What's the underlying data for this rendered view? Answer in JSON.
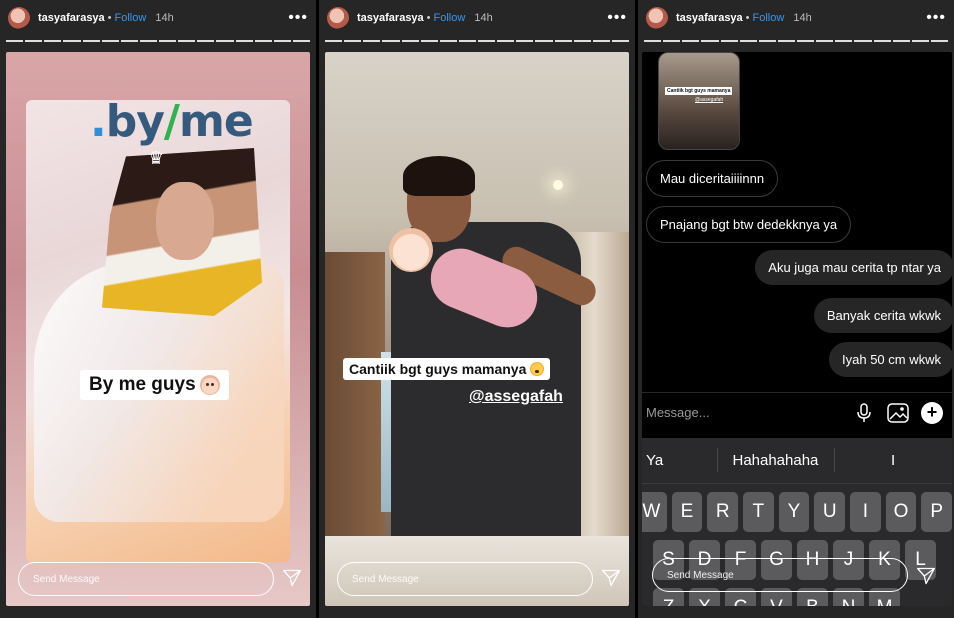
{
  "stories": [
    {
      "username": "tasyafarasya",
      "follow": "Follow",
      "time": "14h",
      "logo_text": ".by/me",
      "caption": "By me guys",
      "send_placeholder": "Send Message"
    },
    {
      "username": "tasyafarasya",
      "follow": "Follow",
      "time": "14h",
      "caption": "Cantiik bgt guys mamanya",
      "mention": "@assegafah",
      "send_placeholder": "Send Message"
    },
    {
      "username": "tasyafarasya",
      "follow": "Follow",
      "time": "14h",
      "thumbnail_caption": "Cantiik bgt guys mamanya",
      "thumbnail_mention": "@assegafah",
      "messages": [
        {
          "direction": "in",
          "text": "Mau diceritaiiiinnn"
        },
        {
          "direction": "in",
          "text": "Pnajang bgt btw dedekknya ya"
        },
        {
          "direction": "out",
          "text": "Aku juga mau cerita tp ntar ya"
        },
        {
          "direction": "out",
          "text": "Banyak cerita wkwk"
        },
        {
          "direction": "out",
          "text": "Iyah 50 cm wkwk"
        }
      ],
      "composer_placeholder": "Message...",
      "suggestions": [
        "Ya",
        "Hahahahaha",
        "I"
      ],
      "keyboard": {
        "row1": [
          "W",
          "E",
          "R",
          "T",
          "Y",
          "U",
          "I",
          "O",
          "P"
        ],
        "row2": [
          "S",
          "D",
          "F",
          "G",
          "H",
          "J",
          "K",
          "L"
        ],
        "row3": [
          "Z",
          "X",
          "C",
          "V",
          "B",
          "N",
          "M"
        ]
      },
      "send_placeholder": "Send Message"
    }
  ],
  "colors": {
    "follow_blue": "#3897f0",
    "header_bg": "#262626",
    "outgoing_bubble": "#262626",
    "keyboard_bg": "#2a2a2c",
    "key_bg": "#5b5b5e"
  },
  "icons": [
    "more-icon",
    "send-icon",
    "microphone-icon",
    "gallery-icon",
    "plus-icon",
    "baby-emoji-icon",
    "pleading-emoji-icon"
  ]
}
